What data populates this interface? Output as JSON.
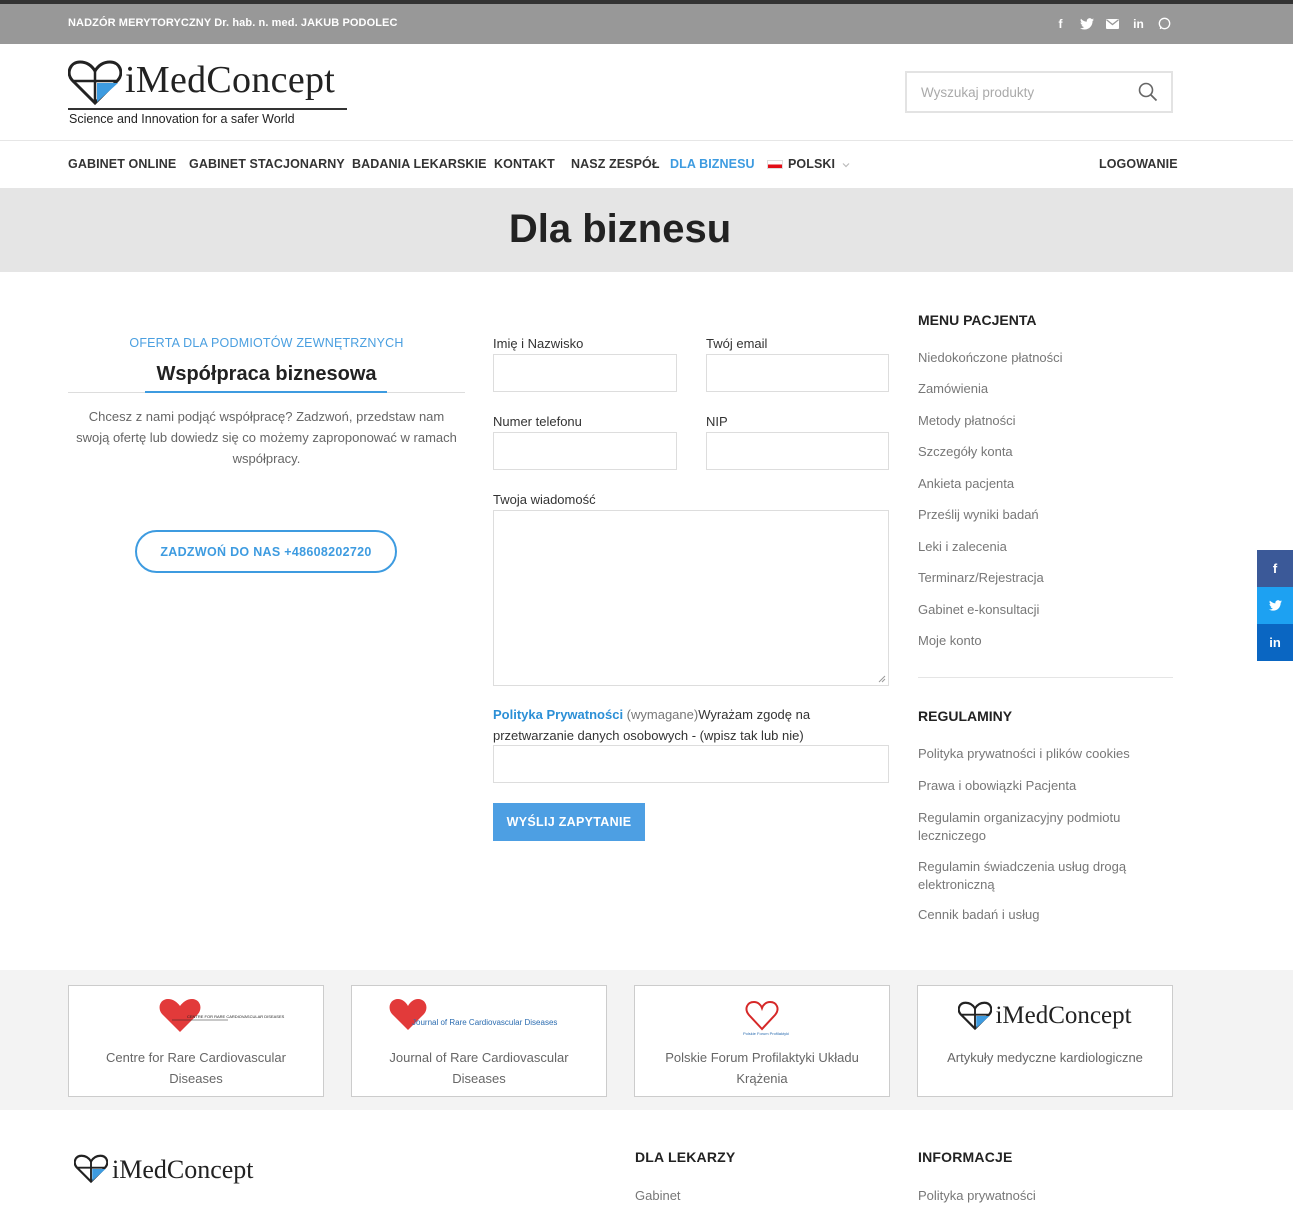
{
  "topbar": {
    "supervision": "NADZÓR MERYTORYCZNY Dr. hab. n. med. JAKUB PODOLEC",
    "socials": [
      "facebook-icon",
      "twitter-icon",
      "mail-icon",
      "linkedin-icon",
      "whatsapp-icon"
    ]
  },
  "brand": {
    "name": "iMedConcept",
    "tagline": "Science and Innovation for a safer World",
    "colors": {
      "blue": "#3d9be0",
      "dark": "#222222"
    }
  },
  "search": {
    "placeholder": "Wyszukaj produkty"
  },
  "nav": {
    "items": [
      "GABINET ONLINE",
      "GABINET STACJONARNY",
      "BADANIA LEKARSKIE",
      "KONTAKT",
      "NASZ ZESPÓŁ",
      "DLA BIZNESU"
    ],
    "active": "DLA BIZNESU",
    "language": "POLSKI",
    "login": "LOGOWANIE"
  },
  "page": {
    "title": "Dla biznesu"
  },
  "offer": {
    "kicker": "OFERTA DLA PODMIOTÓW ZEWNĘTRZNYCH",
    "heading": "Współpraca biznesowa",
    "text": "Chcesz z nami podjąć współpracę? Zadzwoń, przedstaw nam swoją ofertę lub dowiedz się co możemy zaproponować w ramach współpracy.",
    "call_button": "ZADZWOŃ DO NAS +48608202720"
  },
  "form": {
    "name_label": "Imię i Nazwisko",
    "email_label": "Twój email",
    "phone_label": "Numer telefonu",
    "nip_label": "NIP",
    "message_label": "Twoja wiadomość",
    "privacy_link": "Polityka Prywatności",
    "privacy_required": " (wymagane)",
    "privacy_text": "Wyrażam zgodę na przetwarzanie danych osobowych - (wpisz tak lub nie)",
    "submit": "WYŚLIJ ZAPYTANIE"
  },
  "sidebar": {
    "patient_menu_title": "MENU PACJENTA",
    "patient_menu": [
      "Niedokończone płatności",
      "Zamówienia",
      "Metody płatności",
      "Szczegóły konta",
      "Ankieta pacjenta",
      "Prześlij wyniki badań",
      "Leki i zalecenia",
      "Terminarz/Rejestracja",
      "Gabinet e-konsultacji",
      "Moje konto"
    ],
    "regulations_title": "REGULAMINY",
    "regulations": [
      "Polityka prywatności i plików cookies",
      "Prawa i obowiązki Pacjenta",
      "Regulamin organizacyjny podmiotu leczniczego",
      "Regulamin świadczenia usług drogą elektroniczną",
      "Cennik badań i usług"
    ]
  },
  "share": [
    "facebook-icon",
    "twitter-icon",
    "linkedin-icon"
  ],
  "partners": [
    {
      "caption": "Centre for Rare Cardiovascular Diseases",
      "logo_text": "CENTRE FOR RARE CARDIOVASCULAR DISEASES"
    },
    {
      "caption": "Journal of Rare Cardiovascular Diseases",
      "logo_text": "Journal of Rare Cardiovascular Diseases"
    },
    {
      "caption": "Polskie Forum Profilaktyki Układu Krążenia",
      "logo_text": "Polskie Forum Profilaktyki"
    },
    {
      "caption": "Artykuły medyczne kardiologiczne",
      "logo_text": "iMedConcept"
    }
  ],
  "footer": {
    "doctors_title": "DLA LEKARZY",
    "doctors_links": [
      "Gabinet"
    ],
    "info_title": "INFORMACJE",
    "info_links": [
      "Polityka prywatności"
    ]
  }
}
